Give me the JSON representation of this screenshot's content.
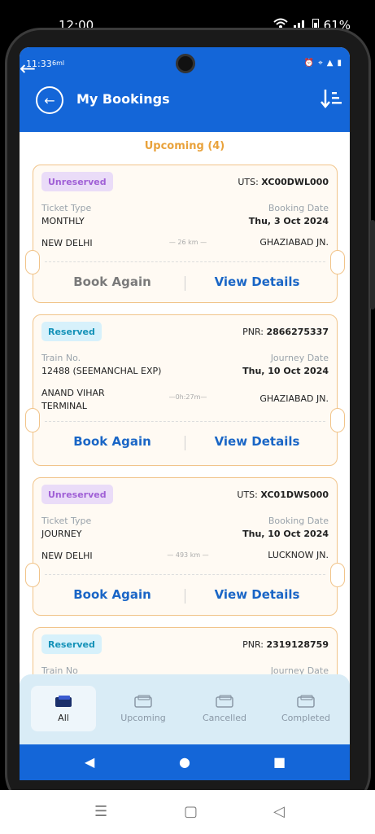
{
  "device": {
    "status_time": "12:00",
    "status_right": "61%"
  },
  "inner_status": {
    "time": "11:33",
    "carrier": "6ml"
  },
  "header": {
    "title": "My Bookings"
  },
  "section": {
    "title": "Upcoming (4)"
  },
  "bookings": [
    {
      "badge": "Unreserved",
      "code_label": "UTS:",
      "code": "XC00DWL000",
      "left_label": "Ticket Type",
      "left_value": "MONTHLY",
      "right_label": "Booking Date",
      "right_value": "Thu, 3 Oct 2024",
      "from": "NEW DELHI",
      "distance": "26 km",
      "to": "GHAZIABAD JN.",
      "book_again": "Book Again",
      "view_details": "View Details"
    },
    {
      "badge": "Reserved",
      "code_label": "PNR:",
      "code": "2866275337",
      "left_label": "Train No.",
      "left_value": "12488 (SEEMANCHAL EXP)",
      "right_label": "Journey Date",
      "right_value": "Thu, 10 Oct 2024",
      "from": "ANAND VIHAR TERMINAL",
      "distance": "0h:27m",
      "to": "GHAZIABAD JN.",
      "book_again": "Book Again",
      "view_details": "View Details"
    },
    {
      "badge": "Unreserved",
      "code_label": "UTS:",
      "code": "XC01DWS000",
      "left_label": "Ticket Type",
      "left_value": "JOURNEY",
      "right_label": "Booking Date",
      "right_value": "Thu, 10 Oct 2024",
      "from": "NEW DELHI",
      "distance": "493 km",
      "to": "LUCKNOW JN.",
      "book_again": "Book Again",
      "view_details": "View Details"
    },
    {
      "badge": "Reserved",
      "code_label": "PNR:",
      "code": "2319128759",
      "left_label": "Train No",
      "right_label": "Journey Date"
    }
  ],
  "bottom_nav": [
    {
      "label": "All",
      "active": true,
      "icon": "ticket-icon"
    },
    {
      "label": "Upcoming",
      "active": false,
      "icon": "ticket-icon"
    },
    {
      "label": "Cancelled",
      "active": false,
      "icon": "ticket-icon"
    },
    {
      "label": "Completed",
      "active": false,
      "icon": "ticket-icon"
    }
  ],
  "colors": {
    "primary": "#1466d8",
    "accent": "#e9a23b",
    "unreserved_badge": "#eadcf8",
    "reserved_badge": "#d7f1fb",
    "link": "#1a66c6"
  }
}
